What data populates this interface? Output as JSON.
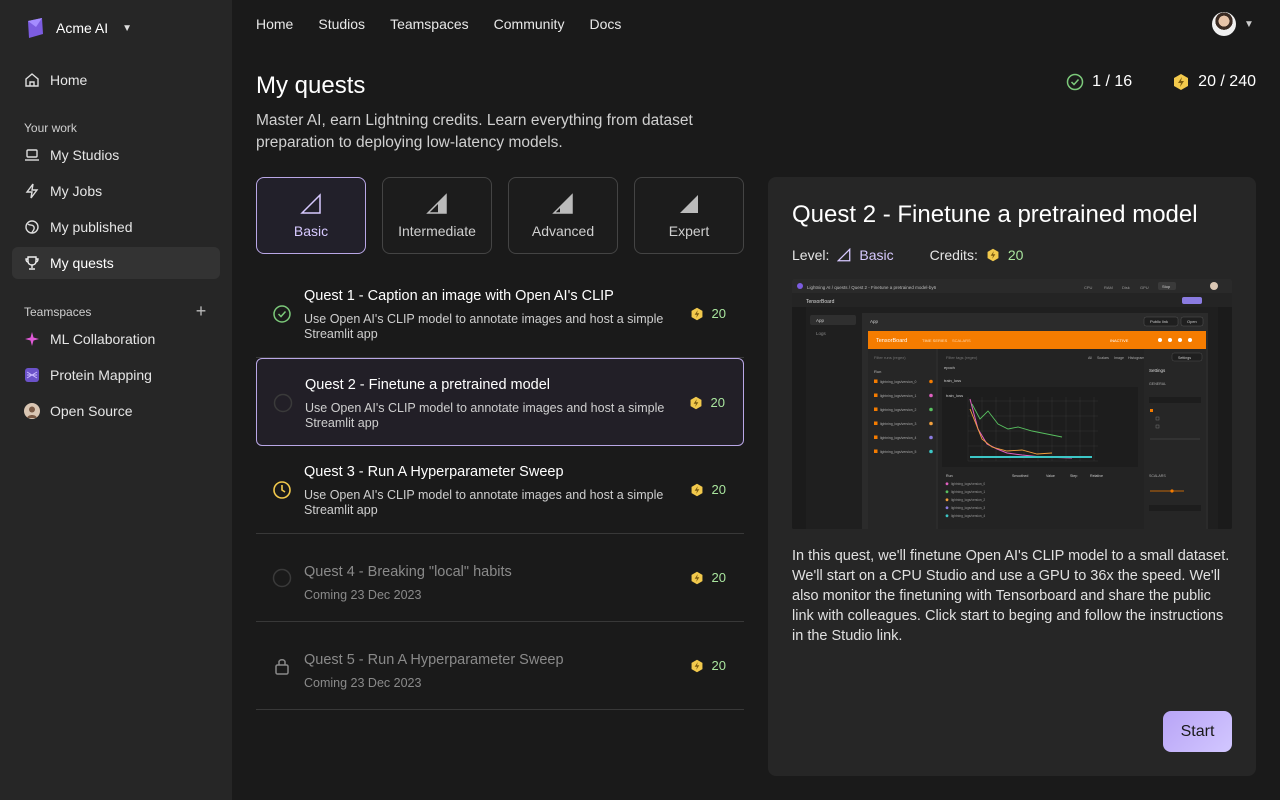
{
  "org": {
    "name": "Acme AI"
  },
  "sidebar": {
    "home": "Home",
    "your_work_label": "Your work",
    "items": [
      {
        "label": "My Studios",
        "icon": "laptop-icon"
      },
      {
        "label": "My Jobs",
        "icon": "lightning-icon"
      },
      {
        "label": "My published",
        "icon": "globe-icon"
      },
      {
        "label": "My quests",
        "icon": "trophy-icon"
      }
    ],
    "teamspaces_label": "Teamspaces",
    "teamspaces": [
      {
        "label": "ML Collaboration",
        "color": "#e05ad7"
      },
      {
        "label": "Protein Mapping",
        "color": "#8a6fe0"
      },
      {
        "label": "Open Source",
        "color": "#c8b09a"
      }
    ]
  },
  "topnav": [
    "Home",
    "Studios",
    "Teamspaces",
    "Community",
    "Docs"
  ],
  "header": {
    "title": "My quests",
    "subtitle": "Master AI, earn Lightning credits. Learn everything from dataset preparation to deploying low-latency models.",
    "completed": "1 / 16",
    "credits": "20 / 240"
  },
  "levels": [
    "Basic",
    "Intermediate",
    "Advanced",
    "Expert"
  ],
  "quests": [
    {
      "title": "Quest 1 - Caption an image with Open AI's CLIP",
      "desc": "Use Open AI's CLIP model to annotate images and host a simple Streamlit app",
      "credits": "20",
      "status": "done"
    },
    {
      "title": "Quest 2 - Finetune a pretrained model",
      "desc": "Use Open AI's CLIP model to annotate images and host a simple Streamlit app",
      "credits": "20",
      "status": "todo"
    },
    {
      "title": "Quest 3 - Run A Hyperparameter Sweep",
      "desc": "Use Open AI's CLIP model to annotate images and host a simple Streamlit app",
      "credits": "20",
      "status": "in-progress"
    },
    {
      "title": "Quest 4 - Breaking \"local\" habits",
      "desc": "Coming 23 Dec 2023",
      "credits": "20",
      "status": "upcoming"
    },
    {
      "title": "Quest 5 - Run A Hyperparameter Sweep",
      "desc": "Coming 23 Dec 2023",
      "credits": "20",
      "status": "locked"
    }
  ],
  "detail": {
    "title": "Quest 2 - Finetune a pretrained model",
    "level_label": "Level:",
    "level": "Basic",
    "credits_label": "Credits:",
    "credits": "20",
    "body": "In this quest, we'll finetune Open AI's CLIP model to a small dataset. We'll start on a CPU Studio and use a GPU to 36x the speed. We'll also monitor the finetuning with Tensorboard and share the public link with colleagues. Click start to beging and follow the instructions in the Studio link.",
    "start": "Start",
    "screenshot": {
      "breadcrumb": "Lightning AI / quests / Quest 2 - Finetune a pretrained model-by6",
      "app_title": "TensorBoard",
      "tabs": [
        "App",
        "Logs"
      ],
      "panel_title": "App",
      "public_link": "Public link",
      "open": "Open",
      "tb_brand": "TensorBoard",
      "tb_tabs": [
        "TIME SERIES",
        "SCALARS"
      ],
      "tb_state": "INACTIVE",
      "filter_runs": "Filter runs (regex)",
      "filter_tags": "Filter tags (regex)",
      "runs_header": "Run",
      "runs": [
        "lightning_logs/version_0",
        "lightning_logs/version_1",
        "lightning_logs/version_2",
        "lightning_logs/version_3",
        "lightning_logs/version_4",
        "lightning_logs/version_5"
      ],
      "sections": [
        "epoch",
        "train_loss"
      ],
      "chart_title": "train_loss",
      "settings_title": "Settings",
      "settings_general": "GENERAL",
      "settings_scalars": "SCALARS",
      "settings_button": "Settings",
      "view_tabs": [
        "All",
        "Scalars",
        "Image",
        "Histogram"
      ],
      "top_status": [
        "CPU",
        "RAM",
        "Disk",
        "GPU"
      ],
      "stop": "Stop",
      "table_headers": [
        "Run",
        "Smoothed",
        "Value",
        "Step",
        "Relative"
      ]
    }
  }
}
